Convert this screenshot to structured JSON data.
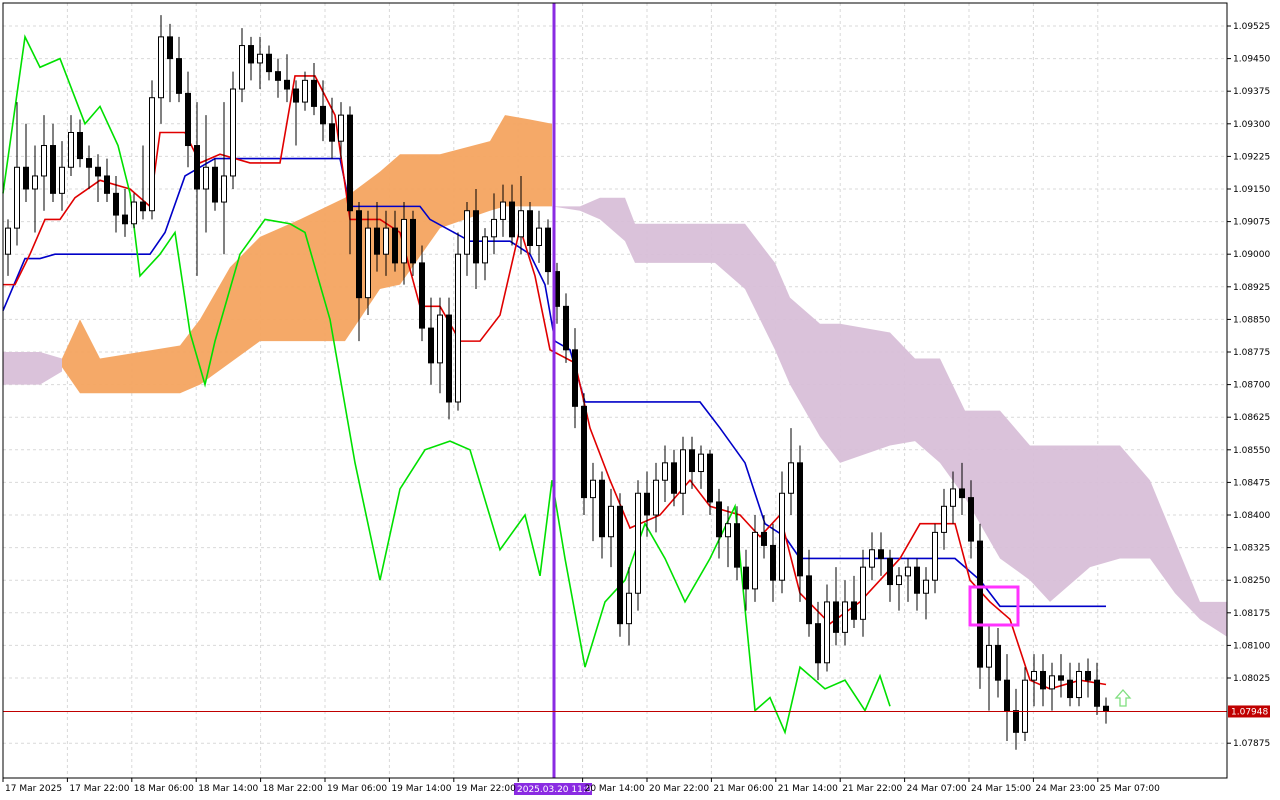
{
  "colors": {
    "background": "#ffffff",
    "grid": "#d9d9d9",
    "candle_bull_body": "#ffffff",
    "candle_bear_body": "#000000",
    "candle_wick": "#000000",
    "tenkan": "#e00000",
    "kijun": "#0000c8",
    "chikou": "#00e000",
    "kumo_bull": "#f4a460",
    "kumo_bear": "#d8bfd8",
    "vertical_marker": "#8a2be2",
    "price_line": "#c00000",
    "highlight_box": "#ff33ff",
    "arrow": "#7fdf7f"
  },
  "chart_data": {
    "type": "candlestick",
    "instrument_note": "",
    "ylim": [
      1.07825,
      1.09575
    ],
    "y_ticks": [
      "1.09525",
      "1.09450",
      "1.09375",
      "1.09300",
      "1.09225",
      "1.09150",
      "1.09075",
      "1.09000",
      "1.08925",
      "1.08850",
      "1.08775",
      "1.08700",
      "1.08625",
      "1.08550",
      "1.08475",
      "1.08400",
      "1.08325",
      "1.08250",
      "1.08175",
      "1.08100",
      "1.08025",
      "1.07875"
    ],
    "x_ticks": [
      "17 Mar 2025",
      "17 Mar 22:00",
      "18 Mar 06:00",
      "18 Mar 14:00",
      "18 Mar 22:00",
      "19 Mar 06:00",
      "19 Mar 14:00",
      "19 Mar 22:00",
      "2025.03.20 11:00",
      "20 Mar 14:00",
      "20 Mar 22:00",
      "21 Mar 06:00",
      "21 Mar 14:00",
      "21 Mar 22:00",
      "24 Mar 07:00",
      "24 Mar 15:00",
      "24 Mar 23:00",
      "25 Mar 07:00"
    ],
    "current_price": "1.07948",
    "highlight_label": "2025.03.20 11:00",
    "candles": [
      [
        1.09,
        1.0908,
        1.0895,
        1.0906
      ],
      [
        1.0906,
        1.0935,
        1.0902,
        1.092
      ],
      [
        1.092,
        1.093,
        1.0912,
        1.0915
      ],
      [
        1.0915,
        1.0925,
        1.0905,
        1.0918
      ],
      [
        1.0918,
        1.0932,
        1.091,
        1.0925
      ],
      [
        1.0925,
        1.093,
        1.0912,
        1.0914
      ],
      [
        1.0914,
        1.0926,
        1.091,
        1.092
      ],
      [
        1.092,
        1.0932,
        1.0918,
        1.0928
      ],
      [
        1.0928,
        1.0931,
        1.092,
        1.0922
      ],
      [
        1.0922,
        1.0925,
        1.0915,
        1.092
      ],
      [
        1.092,
        1.0923,
        1.0912,
        1.0918
      ],
      [
        1.0918,
        1.0922,
        1.0912,
        1.0914
      ],
      [
        1.0914,
        1.0918,
        1.0905,
        1.0909
      ],
      [
        1.0909,
        1.0915,
        1.0904,
        1.0907
      ],
      [
        1.0907,
        1.0914,
        1.0906,
        1.0912
      ],
      [
        1.0912,
        1.0925,
        1.0908,
        1.091
      ],
      [
        1.091,
        1.094,
        1.0908,
        1.0936
      ],
      [
        1.0936,
        1.0955,
        1.093,
        1.095
      ],
      [
        1.095,
        1.0953,
        1.0935,
        1.0945
      ],
      [
        1.0945,
        1.095,
        1.0935,
        1.0937
      ],
      [
        1.0937,
        1.0942,
        1.092,
        1.0925
      ],
      [
        1.0925,
        1.0935,
        1.0895,
        1.0915
      ],
      [
        1.0915,
        1.0932,
        1.0905,
        1.092
      ],
      [
        1.092,
        1.0922,
        1.091,
        1.0912
      ],
      [
        1.0912,
        1.0935,
        1.09,
        1.0918
      ],
      [
        1.0918,
        1.0942,
        1.0915,
        1.0938
      ],
      [
        1.0938,
        1.0952,
        1.0935,
        1.0948
      ],
      [
        1.0948,
        1.095,
        1.094,
        1.0944
      ],
      [
        1.0944,
        1.095,
        1.0938,
        1.0946
      ],
      [
        1.0946,
        1.0948,
        1.094,
        1.0942
      ],
      [
        1.0942,
        1.0945,
        1.0936,
        1.094
      ],
      [
        1.094,
        1.0946,
        1.0935,
        1.0938
      ],
      [
        1.0938,
        1.094,
        1.0925,
        1.0935
      ],
      [
        1.0935,
        1.0942,
        1.0933,
        1.094
      ],
      [
        1.094,
        1.0944,
        1.0932,
        1.0934
      ],
      [
        1.0934,
        1.094,
        1.0926,
        1.093
      ],
      [
        1.093,
        1.0936,
        1.0922,
        1.0926
      ],
      [
        1.0926,
        1.0935,
        1.0922,
        1.0932
      ],
      [
        1.0932,
        1.0934,
        1.09,
        1.091
      ],
      [
        1.091,
        1.0912,
        1.088,
        1.089
      ],
      [
        1.089,
        1.091,
        1.0886,
        1.0906
      ],
      [
        1.0906,
        1.0912,
        1.0896,
        1.09
      ],
      [
        1.09,
        1.091,
        1.0895,
        1.0906
      ],
      [
        1.0906,
        1.091,
        1.0896,
        1.0898
      ],
      [
        1.0898,
        1.0912,
        1.0893,
        1.0908
      ],
      [
        1.0908,
        1.091,
        1.0895,
        1.0898
      ],
      [
        1.0898,
        1.0902,
        1.088,
        1.0883
      ],
      [
        1.0883,
        1.089,
        1.087,
        1.0875
      ],
      [
        1.0875,
        1.089,
        1.0868,
        1.0886
      ],
      [
        1.0886,
        1.089,
        1.0862,
        1.0866
      ],
      [
        1.0866,
        1.0905,
        1.0864,
        1.09
      ],
      [
        1.09,
        1.0912,
        1.0895,
        1.091
      ],
      [
        1.091,
        1.0915,
        1.0892,
        1.0898
      ],
      [
        1.0898,
        1.0906,
        1.0894,
        1.0904
      ],
      [
        1.0904,
        1.0914,
        1.09,
        1.0908
      ],
      [
        1.0908,
        1.0916,
        1.0904,
        1.0912
      ],
      [
        1.0912,
        1.0916,
        1.0902,
        1.0904
      ],
      [
        1.0904,
        1.0918,
        1.09,
        1.091
      ],
      [
        1.091,
        1.0912,
        1.09,
        1.0902
      ],
      [
        1.0902,
        1.091,
        1.0898,
        1.0906
      ],
      [
        1.0906,
        1.0908,
        1.0893,
        1.0896
      ],
      [
        1.0896,
        1.0898,
        1.0884,
        1.0888
      ],
      [
        1.0888,
        1.0891,
        1.0875,
        1.0878
      ],
      [
        1.0878,
        1.0883,
        1.086,
        1.0865
      ],
      [
        1.0865,
        1.0868,
        1.084,
        1.0844
      ],
      [
        1.0844,
        1.0852,
        1.0834,
        1.0848
      ],
      [
        1.0848,
        1.085,
        1.083,
        1.0835
      ],
      [
        1.0835,
        1.0846,
        1.0828,
        1.0842
      ],
      [
        1.0842,
        1.0845,
        1.0812,
        1.0815
      ],
      [
        1.0815,
        1.0828,
        1.081,
        1.0822
      ],
      [
        1.0822,
        1.0848,
        1.0818,
        1.0845
      ],
      [
        1.0845,
        1.085,
        1.0835,
        1.084
      ],
      [
        1.084,
        1.0852,
        1.0836,
        1.0848
      ],
      [
        1.0848,
        1.0856,
        1.0843,
        1.0852
      ],
      [
        1.0852,
        1.0855,
        1.0842,
        1.0845
      ],
      [
        1.0845,
        1.0858,
        1.084,
        1.0855
      ],
      [
        1.0855,
        1.0858,
        1.0846,
        1.085
      ],
      [
        1.085,
        1.0856,
        1.0846,
        1.0854
      ],
      [
        1.0854,
        1.0855,
        1.084,
        1.0843
      ],
      [
        1.0843,
        1.0846,
        1.083,
        1.0835
      ],
      [
        1.0835,
        1.0842,
        1.0828,
        1.0838
      ],
      [
        1.0838,
        1.0842,
        1.0825,
        1.0828
      ],
      [
        1.0828,
        1.0832,
        1.0818,
        1.0823
      ],
      [
        1.0823,
        1.084,
        1.082,
        1.0836
      ],
      [
        1.0836,
        1.084,
        1.083,
        1.0833
      ],
      [
        1.0833,
        1.0838,
        1.082,
        1.0825
      ],
      [
        1.0825,
        1.085,
        1.0822,
        1.0845
      ],
      [
        1.0845,
        1.086,
        1.084,
        1.0852
      ],
      [
        1.0852,
        1.0856,
        1.082,
        1.0826
      ],
      [
        1.0826,
        1.0832,
        1.0812,
        1.0815
      ],
      [
        1.0815,
        1.082,
        1.0802,
        1.0806
      ],
      [
        1.0806,
        1.0824,
        1.0804,
        1.082
      ],
      [
        1.082,
        1.0828,
        1.081,
        1.0813
      ],
      [
        1.0813,
        1.0825,
        1.081,
        1.082
      ],
      [
        1.082,
        1.0826,
        1.0814,
        1.0816
      ],
      [
        1.0816,
        1.0832,
        1.0812,
        1.0828
      ],
      [
        1.0828,
        1.0836,
        1.0825,
        1.0832
      ],
      [
        1.0832,
        1.0836,
        1.0826,
        1.083
      ],
      [
        1.083,
        1.0832,
        1.082,
        1.0824
      ],
      [
        1.0824,
        1.0828,
        1.0818,
        1.0826
      ],
      [
        1.0826,
        1.083,
        1.082,
        1.0828
      ],
      [
        1.0828,
        1.083,
        1.0818,
        1.0822
      ],
      [
        1.0822,
        1.0828,
        1.0816,
        1.0825
      ],
      [
        1.0825,
        1.0838,
        1.0822,
        1.0836
      ],
      [
        1.0836,
        1.0846,
        1.0832,
        1.0842
      ],
      [
        1.0842,
        1.085,
        1.0838,
        1.0846
      ],
      [
        1.0846,
        1.0852,
        1.084,
        1.0844
      ],
      [
        1.0844,
        1.0848,
        1.083,
        1.0834
      ],
      [
        1.0834,
        1.0838,
        1.08,
        1.0805
      ],
      [
        1.0805,
        1.0815,
        1.0795,
        1.081
      ],
      [
        1.081,
        1.0814,
        1.0798,
        1.0802
      ],
      [
        1.0802,
        1.0808,
        1.0788,
        1.0795
      ],
      [
        1.0795,
        1.08,
        1.0786,
        1.079
      ],
      [
        1.079,
        1.0805,
        1.0788,
        1.0802
      ],
      [
        1.0802,
        1.0808,
        1.0796,
        1.0804
      ],
      [
        1.0804,
        1.0808,
        1.0796,
        1.08
      ],
      [
        1.08,
        1.0806,
        1.0795,
        1.0803
      ],
      [
        1.0803,
        1.0808,
        1.0798,
        1.0802
      ],
      [
        1.0802,
        1.0806,
        1.0796,
        1.0798
      ],
      [
        1.0798,
        1.0806,
        1.0796,
        1.0804
      ],
      [
        1.0804,
        1.0807,
        1.0798,
        1.0802
      ],
      [
        1.0802,
        1.0806,
        1.0794,
        1.0796
      ],
      [
        1.0796,
        1.0798,
        1.0792,
        1.0795
      ]
    ]
  }
}
